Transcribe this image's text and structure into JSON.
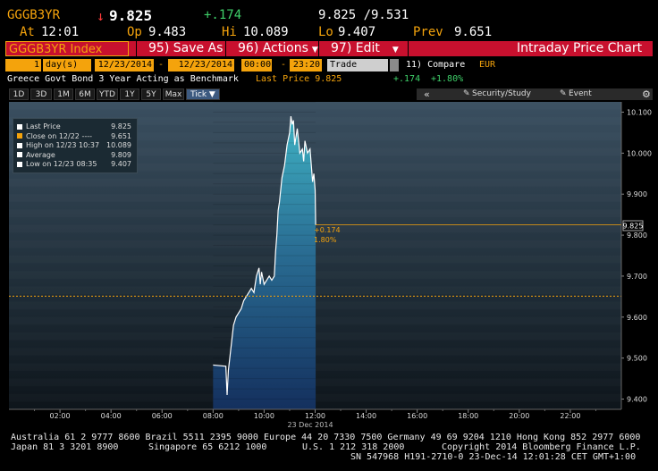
{
  "header": {
    "ticker": "GGGB3YR",
    "arrow": "↓",
    "last": "9.825",
    "change": "+.174",
    "bidask": "9.825 /9.531",
    "at_label": "At",
    "at_time": "12:01",
    "op_label": "Op",
    "op": "9.483",
    "hi_label": "Hi",
    "hi": "10.089",
    "lo_label": "Lo",
    "lo": "9.407",
    "prev_label": "Prev",
    "prev": "9.651"
  },
  "menu": {
    "index_label": "GGGB3YR Index",
    "save_as": "95) Save As",
    "actions": "96) Actions",
    "edit": "97) Edit",
    "title": "Intraday Price Chart"
  },
  "controls": {
    "period_count": "1",
    "period_unit": "day(s)",
    "start_date": "12/23/2014",
    "dash": "-",
    "end_date": "12/23/2014",
    "start_time": "00:00",
    "end_time": "23:20",
    "field": "Trade",
    "compare": "11) Compare",
    "currency": "EUR"
  },
  "info": {
    "description": "Greece Govt Bond 3 Year Acting as Benchmark",
    "last_price_label": "Last Price 9.825",
    "change": "+.174",
    "change_pct": "+1.80%"
  },
  "timeframes": [
    "1D",
    "3D",
    "1M",
    "6M",
    "YTD",
    "1Y",
    "5Y",
    "Max",
    "Tick ▼"
  ],
  "toolbar": {
    "collapse": "«",
    "security": "Security/Study",
    "event": "Event",
    "gear": "gear-icon"
  },
  "legend": {
    "items": [
      {
        "label": "Last Price",
        "value": "9.825",
        "color": "#ffffff"
      },
      {
        "label": "Close on 12/22 ----",
        "value": "9.651",
        "color": "#f4a30c"
      },
      {
        "label": "High on 12/23 10:37",
        "value": "10.089",
        "color": "#ffffff"
      },
      {
        "label": "Average",
        "value": "9.809",
        "color": "#ffffff"
      },
      {
        "label": "Low on 12/23 08:35",
        "value": "9.407",
        "color": "#ffffff"
      }
    ]
  },
  "chart_data": {
    "type": "area",
    "title": "",
    "xlabel": "23 Dec 2014",
    "ylabel": "",
    "x_ticks": [
      "02:00",
      "04:00",
      "06:00",
      "08:00",
      "10:00",
      "12:00",
      "14:00",
      "16:00",
      "18:00",
      "20:00",
      "22:00"
    ],
    "y_ticks": [
      "9.400",
      "9.500",
      "9.600",
      "9.700",
      "9.800",
      "9.900",
      "10.000",
      "10.100"
    ],
    "ylim": [
      9.375,
      10.125
    ],
    "xlim_hours": [
      0,
      24
    ],
    "prev_close": 9.651,
    "last_price_tag": "9.825",
    "annotation_change": "+0.174",
    "annotation_pct": "1.80%",
    "series": [
      {
        "x": [
          8.0,
          8.5,
          8.55,
          8.6,
          8.8,
          8.9,
          9.0,
          9.1,
          9.2,
          9.3,
          9.4,
          9.5,
          9.6,
          9.7,
          9.8,
          9.85,
          9.9,
          10.0,
          10.1,
          10.2,
          10.3,
          10.4,
          10.45,
          10.5,
          10.55,
          10.6,
          10.7,
          10.8,
          10.9,
          11.0,
          11.05,
          11.1,
          11.15,
          11.2,
          11.3,
          11.4,
          11.5,
          11.55,
          11.6,
          11.7,
          11.8,
          11.9,
          11.95,
          12.0,
          12.02
        ],
        "y": [
          9.483,
          9.48,
          9.41,
          9.47,
          9.58,
          9.6,
          9.61,
          9.62,
          9.64,
          9.65,
          9.66,
          9.67,
          9.66,
          9.7,
          9.72,
          9.68,
          9.71,
          9.68,
          9.69,
          9.7,
          9.69,
          9.7,
          9.76,
          9.8,
          9.86,
          9.88,
          9.94,
          9.97,
          10.02,
          10.05,
          10.09,
          10.07,
          10.08,
          10.02,
          10.06,
          10.0,
          10.01,
          9.98,
          10.03,
          10.0,
          10.01,
          9.93,
          9.95,
          9.91,
          9.825
        ]
      }
    ]
  },
  "footer": {
    "line1": "Australia 61 2 9777 8600 Brazil 5511 2395 9000 Europe 44 20 7330 7500 Germany 49 69 9204 1210 Hong Kong 852 2977 6000",
    "line2a": "Japan 81 3 3201 8900",
    "line2b": "Singapore 65 6212 1000",
    "line2c": "U.S. 1 212 318 2000",
    "line2d": "Copyright 2014 Bloomberg Finance L.P.",
    "line3": "SN 547968 H191-2710-0 23-Dec-14 12:01:28 CET  GMT+1:00"
  }
}
